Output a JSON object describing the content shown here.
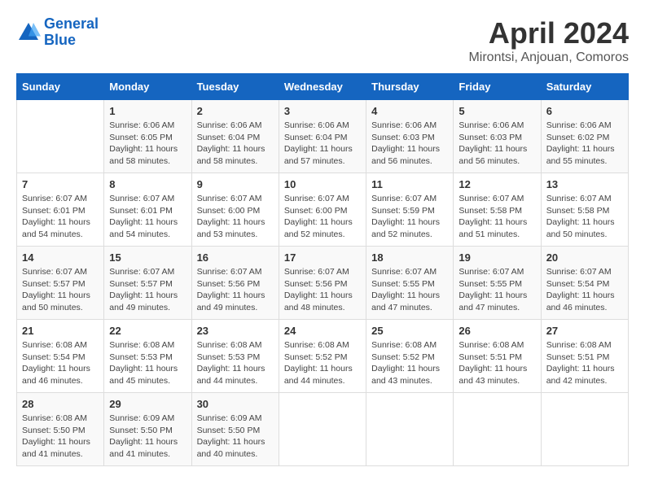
{
  "header": {
    "logo_line1": "General",
    "logo_line2": "Blue",
    "month": "April 2024",
    "location": "Mirontsi, Anjouan, Comoros"
  },
  "days_of_week": [
    "Sunday",
    "Monday",
    "Tuesday",
    "Wednesday",
    "Thursday",
    "Friday",
    "Saturday"
  ],
  "weeks": [
    [
      {
        "day": "",
        "sunrise": "",
        "sunset": "",
        "daylight": ""
      },
      {
        "day": "1",
        "sunrise": "Sunrise: 6:06 AM",
        "sunset": "Sunset: 6:05 PM",
        "daylight": "Daylight: 11 hours and 58 minutes."
      },
      {
        "day": "2",
        "sunrise": "Sunrise: 6:06 AM",
        "sunset": "Sunset: 6:04 PM",
        "daylight": "Daylight: 11 hours and 58 minutes."
      },
      {
        "day": "3",
        "sunrise": "Sunrise: 6:06 AM",
        "sunset": "Sunset: 6:04 PM",
        "daylight": "Daylight: 11 hours and 57 minutes."
      },
      {
        "day": "4",
        "sunrise": "Sunrise: 6:06 AM",
        "sunset": "Sunset: 6:03 PM",
        "daylight": "Daylight: 11 hours and 56 minutes."
      },
      {
        "day": "5",
        "sunrise": "Sunrise: 6:06 AM",
        "sunset": "Sunset: 6:03 PM",
        "daylight": "Daylight: 11 hours and 56 minutes."
      },
      {
        "day": "6",
        "sunrise": "Sunrise: 6:06 AM",
        "sunset": "Sunset: 6:02 PM",
        "daylight": "Daylight: 11 hours and 55 minutes."
      }
    ],
    [
      {
        "day": "7",
        "sunrise": "Sunrise: 6:07 AM",
        "sunset": "Sunset: 6:01 PM",
        "daylight": "Daylight: 11 hours and 54 minutes."
      },
      {
        "day": "8",
        "sunrise": "Sunrise: 6:07 AM",
        "sunset": "Sunset: 6:01 PM",
        "daylight": "Daylight: 11 hours and 54 minutes."
      },
      {
        "day": "9",
        "sunrise": "Sunrise: 6:07 AM",
        "sunset": "Sunset: 6:00 PM",
        "daylight": "Daylight: 11 hours and 53 minutes."
      },
      {
        "day": "10",
        "sunrise": "Sunrise: 6:07 AM",
        "sunset": "Sunset: 6:00 PM",
        "daylight": "Daylight: 11 hours and 52 minutes."
      },
      {
        "day": "11",
        "sunrise": "Sunrise: 6:07 AM",
        "sunset": "Sunset: 5:59 PM",
        "daylight": "Daylight: 11 hours and 52 minutes."
      },
      {
        "day": "12",
        "sunrise": "Sunrise: 6:07 AM",
        "sunset": "Sunset: 5:58 PM",
        "daylight": "Daylight: 11 hours and 51 minutes."
      },
      {
        "day": "13",
        "sunrise": "Sunrise: 6:07 AM",
        "sunset": "Sunset: 5:58 PM",
        "daylight": "Daylight: 11 hours and 50 minutes."
      }
    ],
    [
      {
        "day": "14",
        "sunrise": "Sunrise: 6:07 AM",
        "sunset": "Sunset: 5:57 PM",
        "daylight": "Daylight: 11 hours and 50 minutes."
      },
      {
        "day": "15",
        "sunrise": "Sunrise: 6:07 AM",
        "sunset": "Sunset: 5:57 PM",
        "daylight": "Daylight: 11 hours and 49 minutes."
      },
      {
        "day": "16",
        "sunrise": "Sunrise: 6:07 AM",
        "sunset": "Sunset: 5:56 PM",
        "daylight": "Daylight: 11 hours and 49 minutes."
      },
      {
        "day": "17",
        "sunrise": "Sunrise: 6:07 AM",
        "sunset": "Sunset: 5:56 PM",
        "daylight": "Daylight: 11 hours and 48 minutes."
      },
      {
        "day": "18",
        "sunrise": "Sunrise: 6:07 AM",
        "sunset": "Sunset: 5:55 PM",
        "daylight": "Daylight: 11 hours and 47 minutes."
      },
      {
        "day": "19",
        "sunrise": "Sunrise: 6:07 AM",
        "sunset": "Sunset: 5:55 PM",
        "daylight": "Daylight: 11 hours and 47 minutes."
      },
      {
        "day": "20",
        "sunrise": "Sunrise: 6:07 AM",
        "sunset": "Sunset: 5:54 PM",
        "daylight": "Daylight: 11 hours and 46 minutes."
      }
    ],
    [
      {
        "day": "21",
        "sunrise": "Sunrise: 6:08 AM",
        "sunset": "Sunset: 5:54 PM",
        "daylight": "Daylight: 11 hours and 46 minutes."
      },
      {
        "day": "22",
        "sunrise": "Sunrise: 6:08 AM",
        "sunset": "Sunset: 5:53 PM",
        "daylight": "Daylight: 11 hours and 45 minutes."
      },
      {
        "day": "23",
        "sunrise": "Sunrise: 6:08 AM",
        "sunset": "Sunset: 5:53 PM",
        "daylight": "Daylight: 11 hours and 44 minutes."
      },
      {
        "day": "24",
        "sunrise": "Sunrise: 6:08 AM",
        "sunset": "Sunset: 5:52 PM",
        "daylight": "Daylight: 11 hours and 44 minutes."
      },
      {
        "day": "25",
        "sunrise": "Sunrise: 6:08 AM",
        "sunset": "Sunset: 5:52 PM",
        "daylight": "Daylight: 11 hours and 43 minutes."
      },
      {
        "day": "26",
        "sunrise": "Sunrise: 6:08 AM",
        "sunset": "Sunset: 5:51 PM",
        "daylight": "Daylight: 11 hours and 43 minutes."
      },
      {
        "day": "27",
        "sunrise": "Sunrise: 6:08 AM",
        "sunset": "Sunset: 5:51 PM",
        "daylight": "Daylight: 11 hours and 42 minutes."
      }
    ],
    [
      {
        "day": "28",
        "sunrise": "Sunrise: 6:08 AM",
        "sunset": "Sunset: 5:50 PM",
        "daylight": "Daylight: 11 hours and 41 minutes."
      },
      {
        "day": "29",
        "sunrise": "Sunrise: 6:09 AM",
        "sunset": "Sunset: 5:50 PM",
        "daylight": "Daylight: 11 hours and 41 minutes."
      },
      {
        "day": "30",
        "sunrise": "Sunrise: 6:09 AM",
        "sunset": "Sunset: 5:50 PM",
        "daylight": "Daylight: 11 hours and 40 minutes."
      },
      {
        "day": "",
        "sunrise": "",
        "sunset": "",
        "daylight": ""
      },
      {
        "day": "",
        "sunrise": "",
        "sunset": "",
        "daylight": ""
      },
      {
        "day": "",
        "sunrise": "",
        "sunset": "",
        "daylight": ""
      },
      {
        "day": "",
        "sunrise": "",
        "sunset": "",
        "daylight": ""
      }
    ]
  ]
}
